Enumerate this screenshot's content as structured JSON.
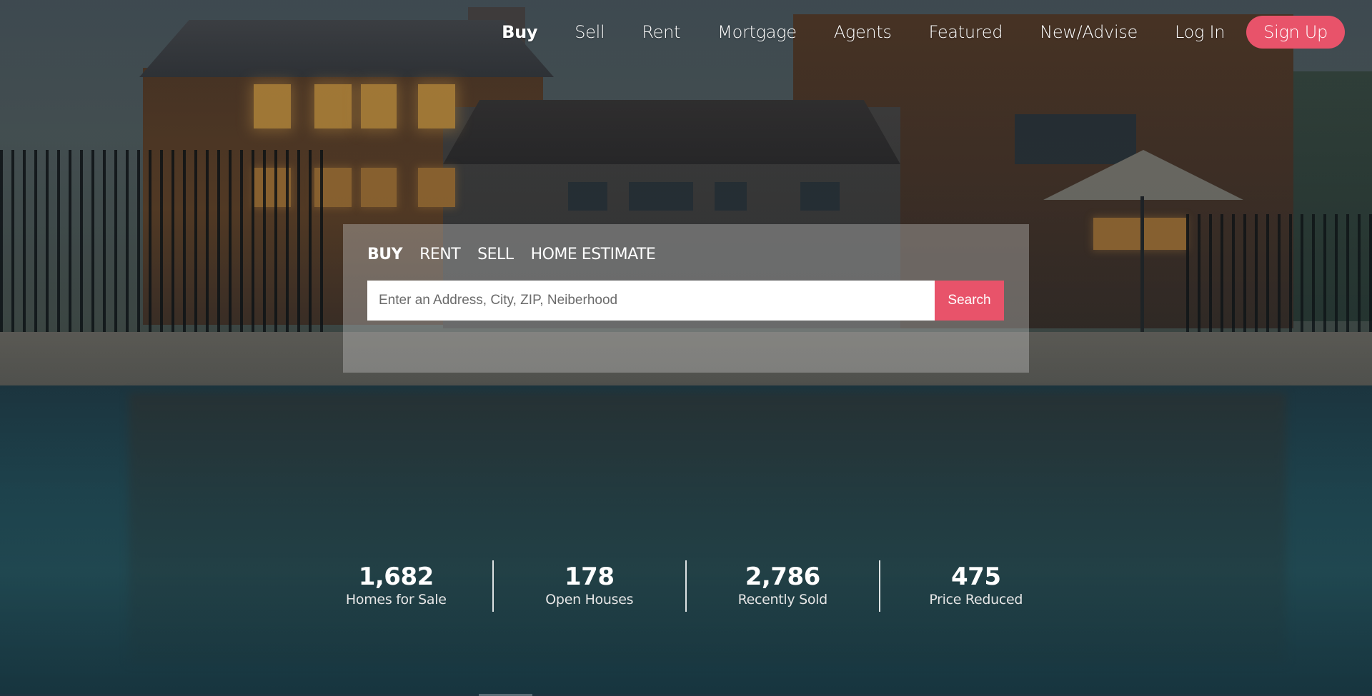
{
  "nav": {
    "items": [
      {
        "label": "Buy",
        "active": true
      },
      {
        "label": "Sell",
        "active": false
      },
      {
        "label": "Rent",
        "active": false
      },
      {
        "label": "Mortgage",
        "active": false
      },
      {
        "label": "Agents",
        "active": false
      },
      {
        "label": "Featured",
        "active": false
      },
      {
        "label": "New/Advise",
        "active": false
      },
      {
        "label": "Log In",
        "active": false
      }
    ],
    "signup_label": "Sign Up"
  },
  "search": {
    "tabs": [
      {
        "label": "BUY",
        "active": true
      },
      {
        "label": "RENT",
        "active": false
      },
      {
        "label": "SELL",
        "active": false
      },
      {
        "label": "HOME ESTIMATE",
        "active": false
      }
    ],
    "placeholder": "Enter an Address, City, ZIP, Neiberhood",
    "value": "",
    "button_label": "Search"
  },
  "stats": [
    {
      "value": "1,682",
      "label": "Homes for Sale"
    },
    {
      "value": "178",
      "label": "Open Houses"
    },
    {
      "value": "2,786",
      "label": "Recently Sold"
    },
    {
      "value": "475",
      "label": "Price Reduced"
    }
  ],
  "colors": {
    "accent": "#e8536a",
    "text": "#ffffff",
    "panel": "rgba(200,200,200,0.38)"
  }
}
